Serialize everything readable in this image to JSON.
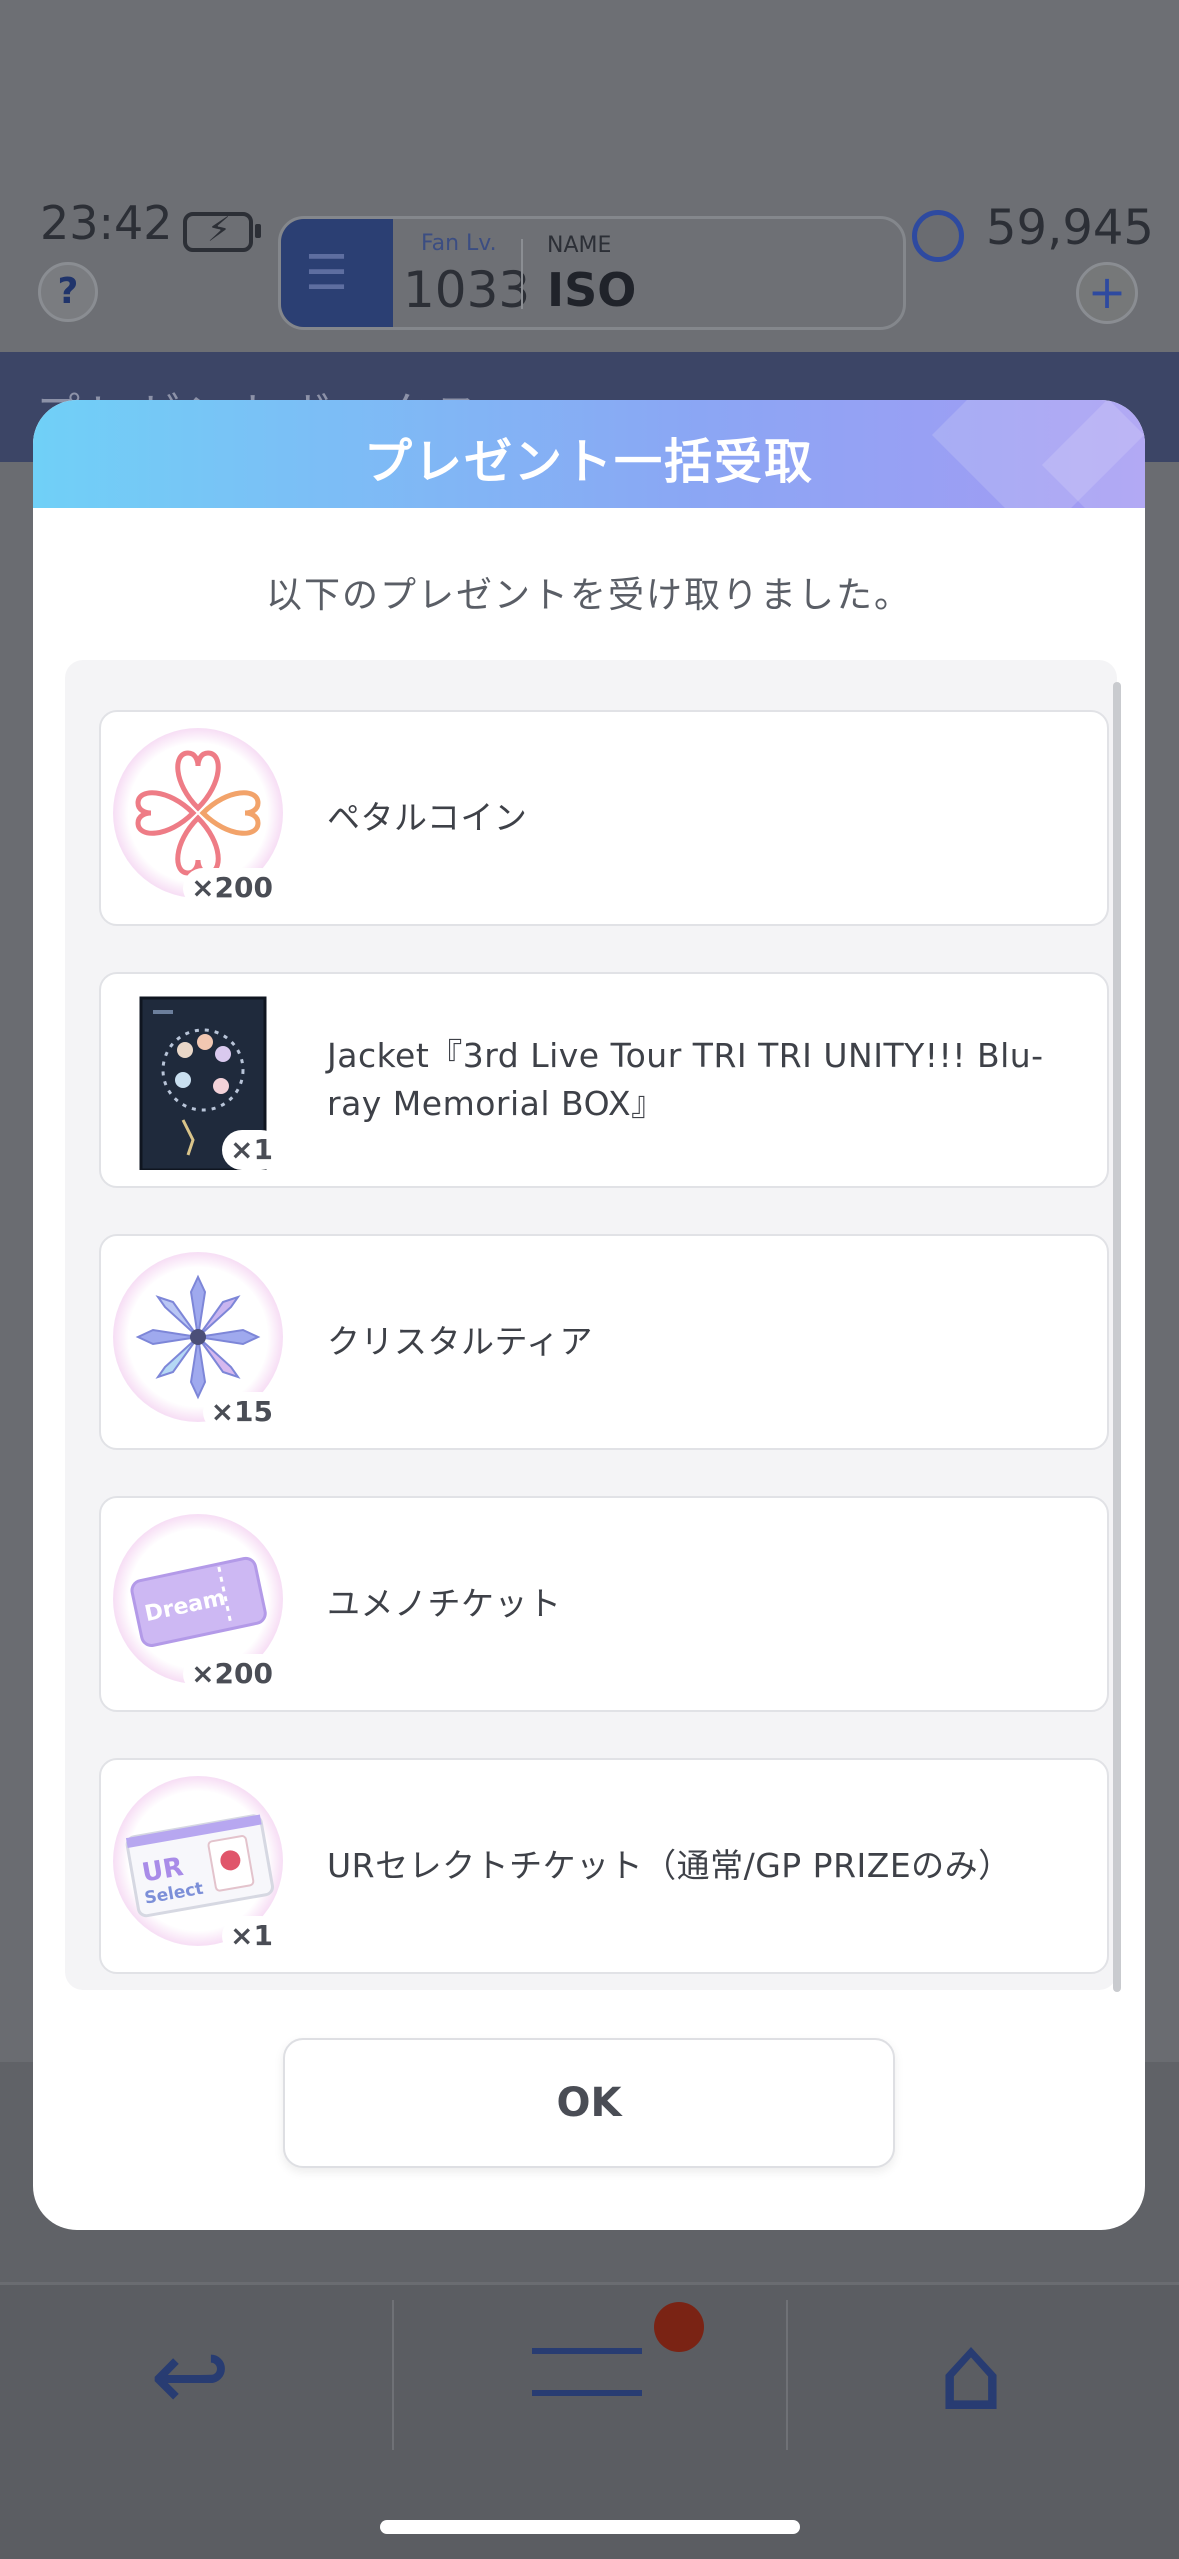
{
  "status_bar": {
    "time": "23:42"
  },
  "header": {
    "fan_level_label": "Fan Lv.",
    "fan_level_value": "1033",
    "name_label": "NAME",
    "name_value": "ISO",
    "currency_value": "59,945"
  },
  "background": {
    "section_title": "プレゼントボックス"
  },
  "dialog": {
    "title": "プレゼント一括受取",
    "subtitle": "以下のプレゼントを受け取りました。",
    "items": [
      {
        "label": "ペタルコイン",
        "quantity": "×200",
        "icon": "petal-coin-icon"
      },
      {
        "label": "Jacket『3rd Live Tour TRI TRI UNITY!!! Blu-ray Memorial BOX』",
        "quantity": "×1",
        "icon": "jacket-thumbnail"
      },
      {
        "label": "クリスタルティア",
        "quantity": "×15",
        "icon": "crystal-tear-icon"
      },
      {
        "label": "ユメノチケット",
        "quantity": "×200",
        "icon": "dream-ticket-icon"
      },
      {
        "label": "URセレクトチケット（通常/GP PRIZEのみ）",
        "quantity": "×1",
        "icon": "ur-select-ticket-icon"
      }
    ],
    "ok_label": "OK"
  },
  "colors": {
    "header_gradient_start": "#70d0f7",
    "header_gradient_end": "#a59af3",
    "overlay": "#5a5d63",
    "nav_icon": "#283c72",
    "notification": "#7a2314"
  }
}
